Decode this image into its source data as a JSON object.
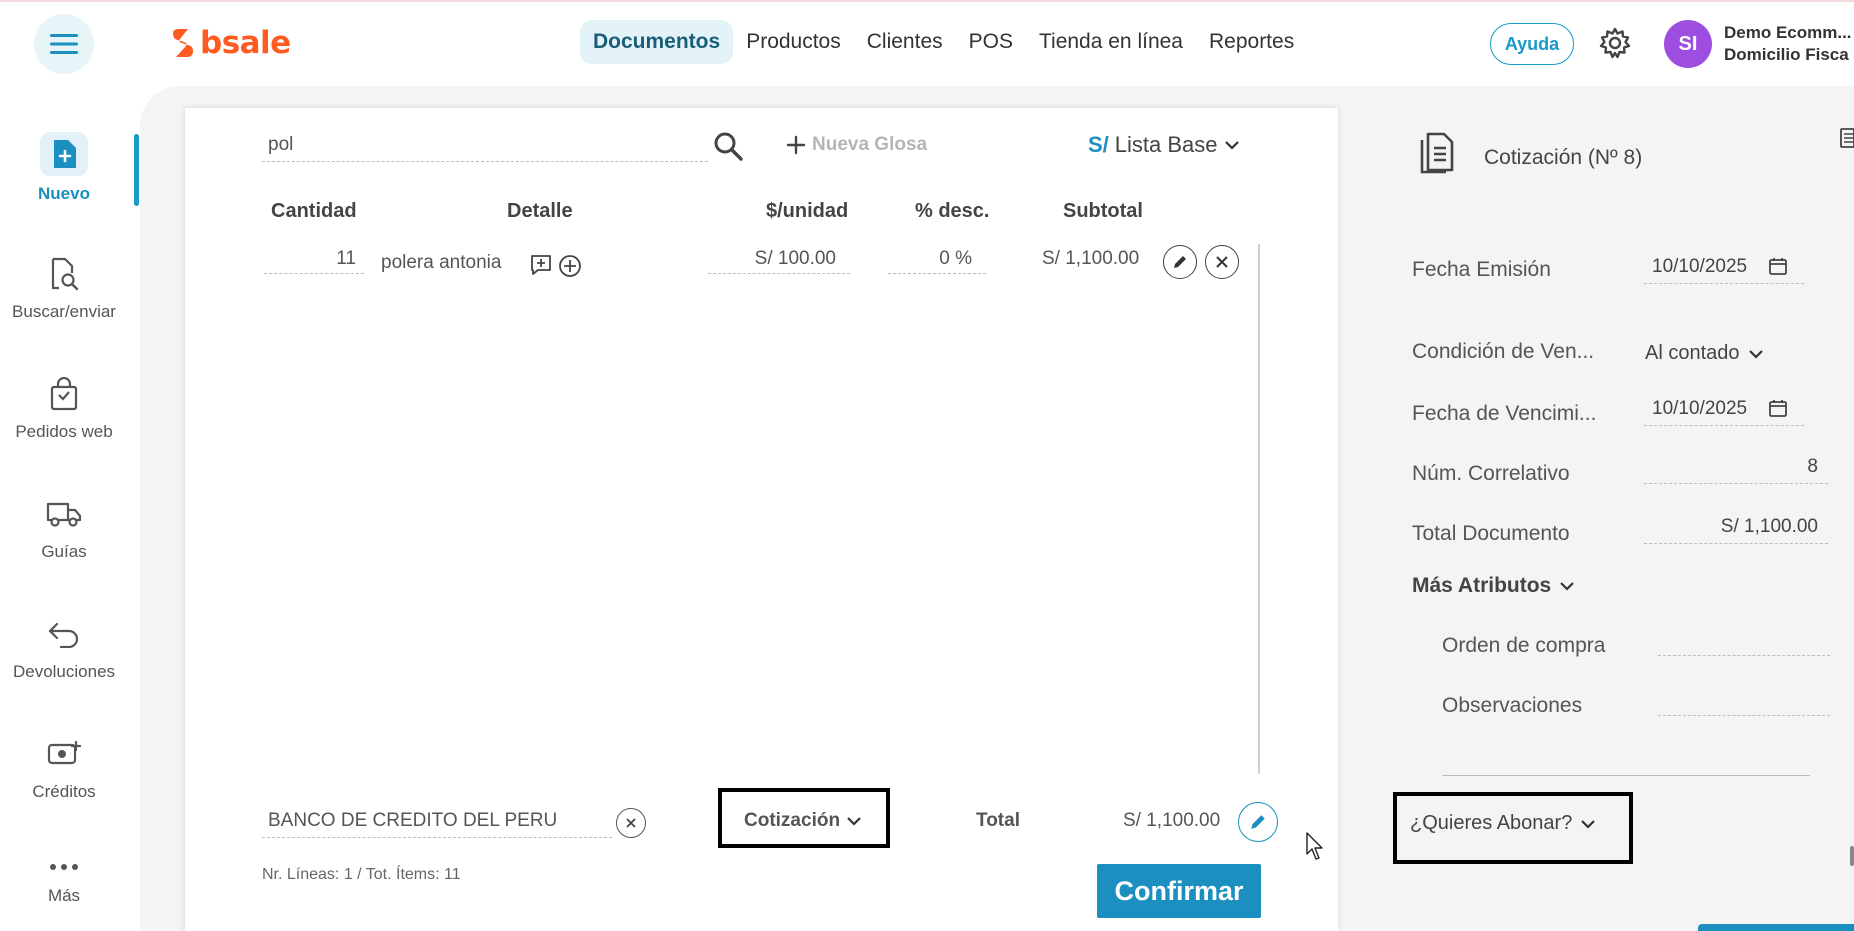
{
  "brand": {
    "name": "bsale"
  },
  "nav": {
    "items": [
      "Documentos",
      "Productos",
      "Clientes",
      "POS",
      "Tienda en línea",
      "Reportes"
    ],
    "active": "Documentos"
  },
  "header": {
    "help_label": "Ayuda",
    "avatar_initials": "SI",
    "user_line1": "Demo Ecomm...",
    "user_line2": "Domicilio Fisca"
  },
  "sidebar": {
    "items": [
      {
        "label": "Nuevo",
        "icon": "new-document-icon"
      },
      {
        "label": "Buscar/enviar",
        "icon": "search-document-icon"
      },
      {
        "label": "Pedidos web",
        "icon": "shopping-bag-icon"
      },
      {
        "label": "Guías",
        "icon": "truck-icon"
      },
      {
        "label": "Devoluciones",
        "icon": "return-arrow-icon"
      },
      {
        "label": "Créditos",
        "icon": "money-plus-icon"
      },
      {
        "label": "Más",
        "icon": "more-dots-icon"
      }
    ]
  },
  "search": {
    "value": "pol"
  },
  "glosa": {
    "label": "Nueva Glosa"
  },
  "price_list": {
    "currency": "S/",
    "label": "Lista Base"
  },
  "table": {
    "headers": [
      "Cantidad",
      "Detalle",
      "$/unidad",
      "% desc.",
      "Subtotal"
    ],
    "rows": [
      {
        "cantidad": "11",
        "detalle": "polera antonia",
        "unidad": "S/ 100.00",
        "desc": "0 %",
        "subtotal": "S/ 1,100.00"
      }
    ]
  },
  "footer": {
    "bank": "BANCO DE CREDITO DEL PERU",
    "doc_type": "Cotización",
    "total_label": "Total",
    "total_value": "S/ 1,100.00",
    "summary": "Nr. Líneas: 1 / Tot. Ítems: 11",
    "confirm_label": "Confirmar"
  },
  "right_panel": {
    "title": "Cotización (Nº 8)",
    "fields": {
      "fecha_emision_label": "Fecha Emisión",
      "fecha_emision_value": "10/10/2025",
      "condicion_label": "Condición de Ven...",
      "condicion_value": "Al contado",
      "fecha_venc_label": "Fecha de Vencimi...",
      "fecha_venc_value": "10/10/2025",
      "correlativo_label": "Núm. Correlativo",
      "correlativo_value": "8",
      "total_label": "Total Documento",
      "total_value": "S/ 1,100.00",
      "mas_atributos": "Más Atributos",
      "orden_label": "Orden de compra",
      "observ_label": "Observaciones"
    },
    "abonar_label": "¿Quieres Abonar?"
  },
  "colors": {
    "accent": "#1a8fc0",
    "brand": "#ff5a1f",
    "avatar": "#9d4ee0"
  }
}
